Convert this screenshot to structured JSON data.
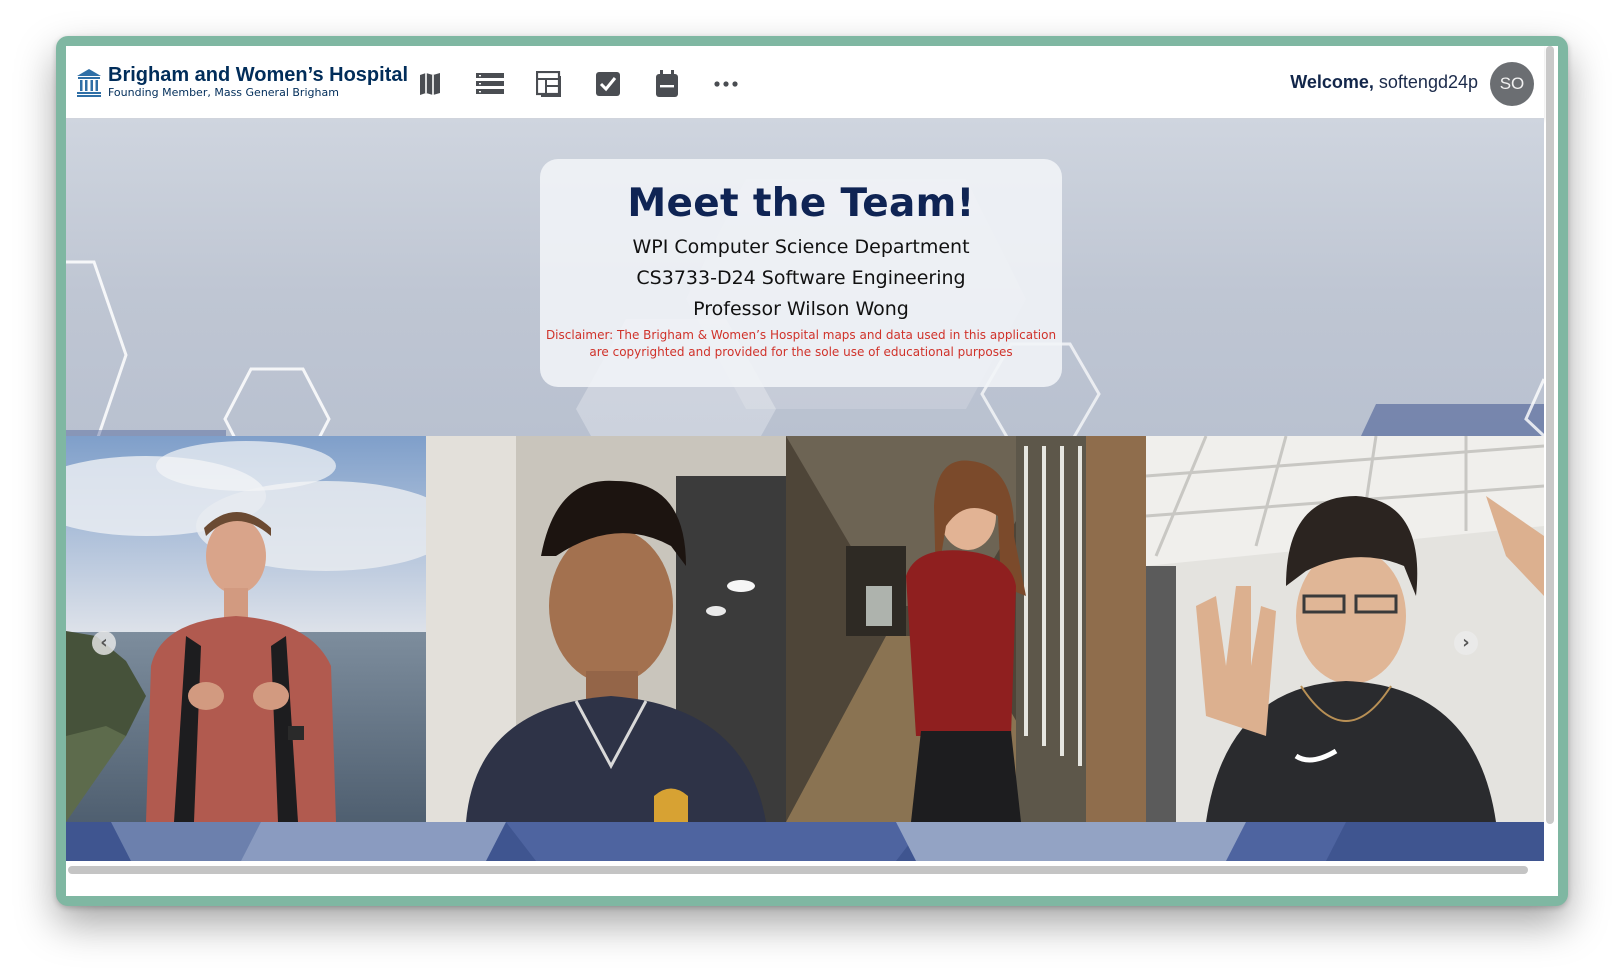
{
  "header": {
    "brand_name": "Brigham and Women’s Hospital",
    "brand_subtitle": "Founding Member, Mass General Brigham",
    "nav_icons": [
      "map-icon",
      "list-icon",
      "dashboard-icon",
      "checkbox-icon",
      "calendar-icon",
      "more-icon"
    ],
    "welcome_label": "Welcome,",
    "username": "softengd24p",
    "avatar_initials": "SO"
  },
  "hero": {
    "title": "Meet the Team!",
    "lines": [
      "WPI Computer Science Department",
      "CS3733-D24 Software Engineering",
      "Professor Wilson Wong"
    ],
    "disclaimer": "Disclaimer: The Brigham & Women’s Hospital maps and data used in this application are copyrighted and provided for the sole use of educational purposes"
  },
  "carousel": {
    "prev_glyph": "‹",
    "next_glyph": "›"
  },
  "colors": {
    "brand_navy": "#012d5a",
    "disclaimer_red": "#d0322a",
    "band_blue": "#3f5590"
  }
}
